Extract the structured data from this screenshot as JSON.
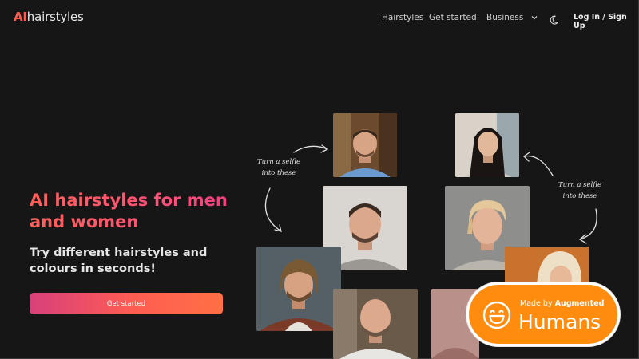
{
  "header": {
    "logo_ai": "AI",
    "logo_rest": "hairstyles",
    "nav": {
      "hairstyles": "Hairstyles",
      "get_started": "Get started",
      "business": "Business"
    },
    "login": "Log In / Sign Up"
  },
  "hero": {
    "title": "AI hairstyles for men and women",
    "subtitle": "Try different hairstyles and colours in seconds!",
    "cta": "Get started"
  },
  "annotations": {
    "left": "Turn a selfie into these",
    "right": "Turn a selfie into these"
  },
  "badge": {
    "made_by": "Made by",
    "brand": "Augmented",
    "humans": "Humans"
  },
  "icons": {
    "business_chevron": "chevron-down-icon",
    "theme": "moon-icon",
    "badge": "smiley-icon"
  },
  "colors": {
    "background": "#161616",
    "accent": "#ff5a4e",
    "badge": "#ff8c0f"
  }
}
